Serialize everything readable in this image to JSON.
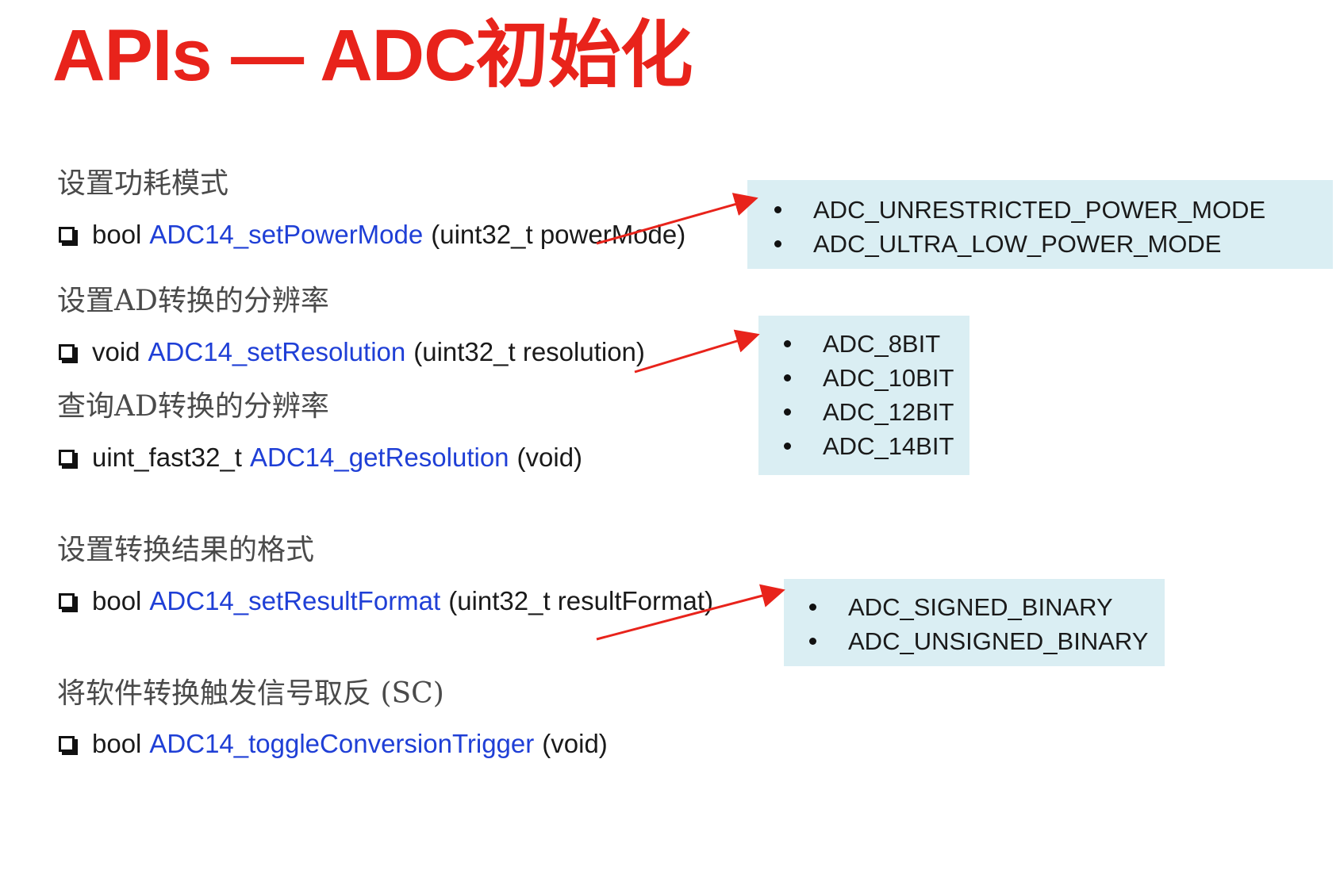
{
  "title": "APIs — ADC初始化",
  "sections": [
    {
      "heading": "设置功耗模式",
      "api": {
        "return_type": "bool",
        "function": "ADC14_setPowerMode",
        "params": "(uint32_t powerMode)"
      }
    },
    {
      "heading": "设置AD转换的分辨率",
      "api": {
        "return_type": "void",
        "function": "ADC14_setResolution",
        "params": "(uint32_t resolution)"
      }
    },
    {
      "heading": "查询AD转换的分辨率",
      "api": {
        "return_type": "uint_fast32_t",
        "function": "ADC14_getResolution",
        "params": "(void)"
      }
    },
    {
      "heading": "设置转换结果的格式",
      "api": {
        "return_type": "bool",
        "function": "ADC14_setResultFormat",
        "params": "(uint32_t resultFormat)"
      }
    },
    {
      "heading": "将软件转换触发信号取反 (SC)",
      "api": {
        "return_type": "bool",
        "function": "ADC14_toggleConversionTrigger",
        "params": "(void)"
      }
    }
  ],
  "option_boxes": {
    "power_mode": [
      "ADC_UNRESTRICTED_POWER_MODE",
      "ADC_ULTRA_LOW_POWER_MODE"
    ],
    "resolution": [
      "ADC_8BIT",
      "ADC_10BIT",
      "ADC_12BIT",
      "ADC_14BIT"
    ],
    "result_format": [
      "ADC_SIGNED_BINARY",
      "ADC_UNSIGNED_BINARY"
    ]
  },
  "colors": {
    "title": "#e8231b",
    "function_name": "#1f3fd6",
    "option_box_bg": "#daeef3",
    "arrow": "#e8231b"
  }
}
